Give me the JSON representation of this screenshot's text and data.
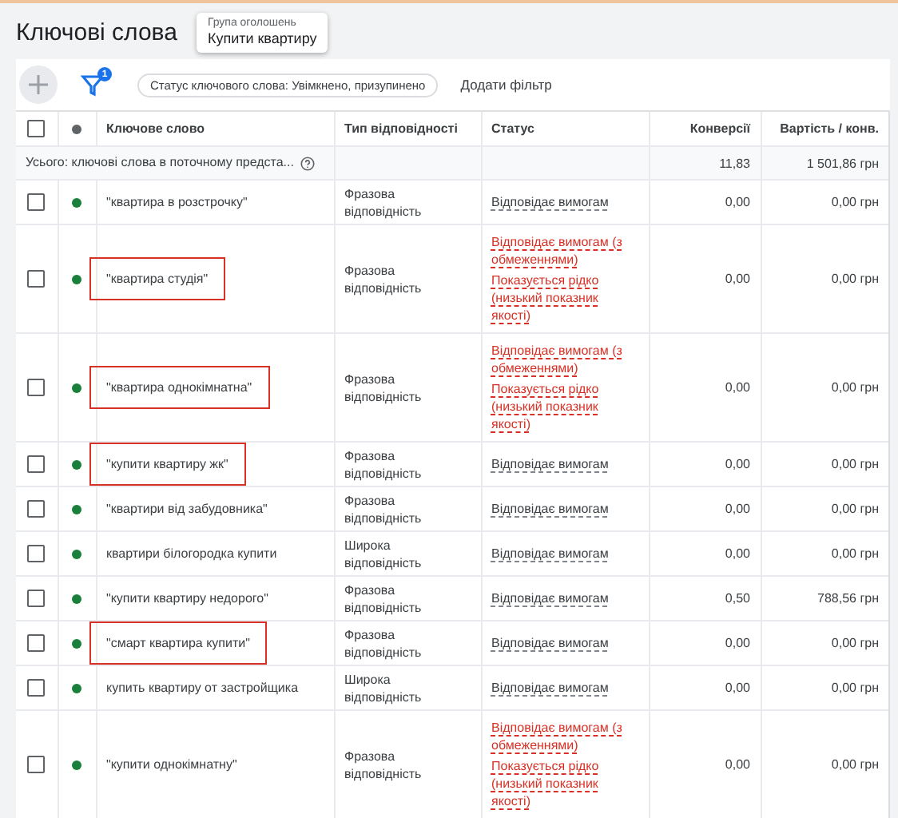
{
  "title": "Ключові слова",
  "ad_group": {
    "label": "Група оголошень",
    "value": "Купити квартиру"
  },
  "toolbar": {
    "filter_count": "1",
    "filter_chip": "Статус ключового слова: Увімкнено, призупинено",
    "add_filter": "Додати фільтр"
  },
  "table": {
    "columns": [
      "Ключове слово",
      "Тип відповідності",
      "Статус",
      "Конверсії",
      "Вартість / конв."
    ],
    "header_checked": false,
    "summary": {
      "label": "Усього: ключові слова в поточному предста...",
      "conversions": "11,83",
      "cost": "1 501,86 грн"
    },
    "rows": [
      {
        "checked": false,
        "keyword": "\"квартира в розстрочку\"",
        "highlighted": false,
        "match": "Фразова відповідність",
        "statuses": [
          {
            "kind": "ok",
            "text": "Відповідає вимогам"
          }
        ],
        "conversions": "0,00",
        "cost": "0,00 грн"
      },
      {
        "checked": false,
        "keyword": "\"квартира студія\"",
        "highlighted": true,
        "match": "Фразова відповідність",
        "statuses": [
          {
            "kind": "limited",
            "text": "Відповідає вимогам (з обмеженнями)"
          },
          {
            "kind": "limited",
            "text": "Показується рідко (низький показник якості)"
          }
        ],
        "conversions": "0,00",
        "cost": "0,00 грн"
      },
      {
        "checked": false,
        "keyword": "\"квартира однокімнатна\"",
        "highlighted": true,
        "match": "Фразова відповідність",
        "statuses": [
          {
            "kind": "limited",
            "text": "Відповідає вимогам (з обмеженнями)"
          },
          {
            "kind": "limited",
            "text": "Показується рідко (низький показник якості)"
          }
        ],
        "conversions": "0,00",
        "cost": "0,00 грн"
      },
      {
        "checked": false,
        "keyword": "\"купити квартиру жк\"",
        "highlighted": true,
        "match": "Фразова відповідність",
        "statuses": [
          {
            "kind": "ok",
            "text": "Відповідає вимогам"
          }
        ],
        "conversions": "0,00",
        "cost": "0,00 грн"
      },
      {
        "checked": false,
        "keyword": "\"квартири від забудовника\"",
        "highlighted": false,
        "match": "Фразова відповідність",
        "statuses": [
          {
            "kind": "ok",
            "text": "Відповідає вимогам"
          }
        ],
        "conversions": "0,00",
        "cost": "0,00 грн"
      },
      {
        "checked": false,
        "keyword": "квартири білогородка купити",
        "highlighted": false,
        "match": "Широка відповідність",
        "statuses": [
          {
            "kind": "ok",
            "text": "Відповідає вимогам"
          }
        ],
        "conversions": "0,00",
        "cost": "0,00 грн"
      },
      {
        "checked": false,
        "keyword": "\"купити квартиру недорого\"",
        "highlighted": false,
        "match": "Фразова відповідність",
        "statuses": [
          {
            "kind": "ok",
            "text": "Відповідає вимогам"
          }
        ],
        "conversions": "0,50",
        "cost": "788,56 грн"
      },
      {
        "checked": false,
        "keyword": "\"смарт квартира купити\"",
        "highlighted": true,
        "match": "Фразова відповідність",
        "statuses": [
          {
            "kind": "ok",
            "text": "Відповідає вимогам"
          }
        ],
        "conversions": "0,00",
        "cost": "0,00 грн"
      },
      {
        "checked": false,
        "keyword": "купить квартиру от застройщика",
        "highlighted": false,
        "match": "Широка відповідність",
        "statuses": [
          {
            "kind": "ok",
            "text": "Відповідає вимогам"
          }
        ],
        "conversions": "0,00",
        "cost": "0,00 грн"
      },
      {
        "checked": false,
        "keyword": "\"купити однокімнатну\"",
        "highlighted": false,
        "match": "Фразова відповідність",
        "statuses": [
          {
            "kind": "limited",
            "text": "Відповідає вимогам (з обмеженнями)"
          },
          {
            "kind": "limited",
            "text": "Показується рідко (низький показник якості)"
          }
        ],
        "conversions": "0,00",
        "cost": "0,00 грн"
      }
    ]
  }
}
